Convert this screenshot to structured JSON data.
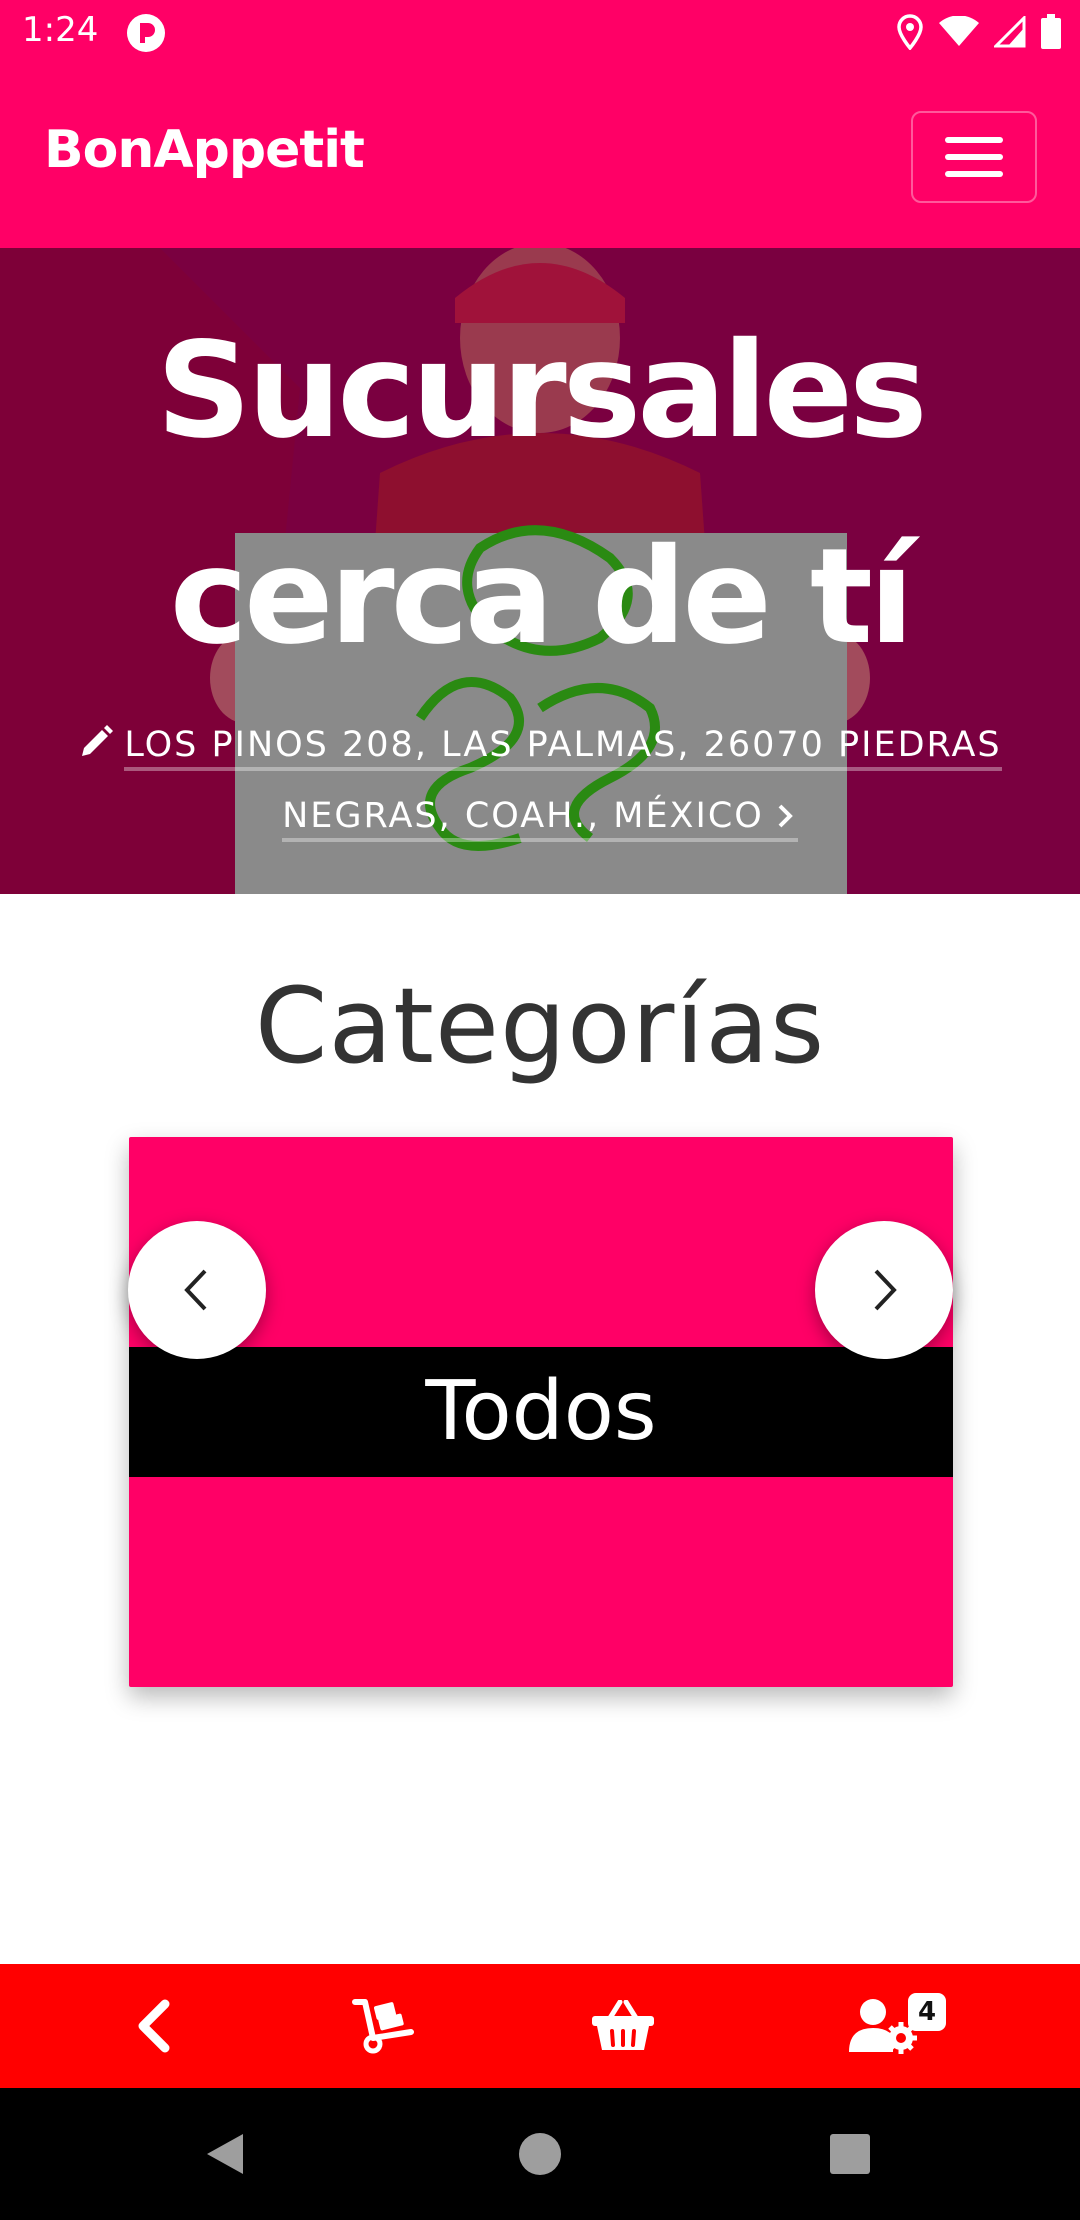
{
  "status_bar": {
    "time": "1:24",
    "icons": [
      "app-notification-icon",
      "location-icon",
      "wifi-icon",
      "signal-icon",
      "battery-icon"
    ]
  },
  "header": {
    "brand": "BonAppetit",
    "menu_icon": "hamburger-menu-icon",
    "background_color": "#ff0066"
  },
  "hero": {
    "title_line1": "Sucursales",
    "title_line2": "cerca de tí",
    "address_line1": "LOS PINOS 208, LAS PALMAS, 26070 PIEDRAS",
    "address_line2": "NEGRAS, COAH., MÉXICO",
    "address_icon": "pencil-icon",
    "address_chevron": "chevron-right-icon",
    "overlay_color": "#7a0040"
  },
  "categories": {
    "title": "Categorías",
    "selected": "Todos",
    "card_color": "#ff0066",
    "prev_icon": "chevron-left-icon",
    "next_icon": "chevron-right-icon"
  },
  "bottom_nav": {
    "background_color": "#ff0000",
    "items": [
      {
        "icon": "back-arrow-icon"
      },
      {
        "icon": "hand-truck-icon"
      },
      {
        "icon": "shopping-basket-icon"
      },
      {
        "icon": "user-settings-icon",
        "badge": "4"
      }
    ]
  },
  "system_nav": {
    "items": [
      "back-triangle-icon",
      "home-circle-icon",
      "recents-square-icon"
    ]
  }
}
